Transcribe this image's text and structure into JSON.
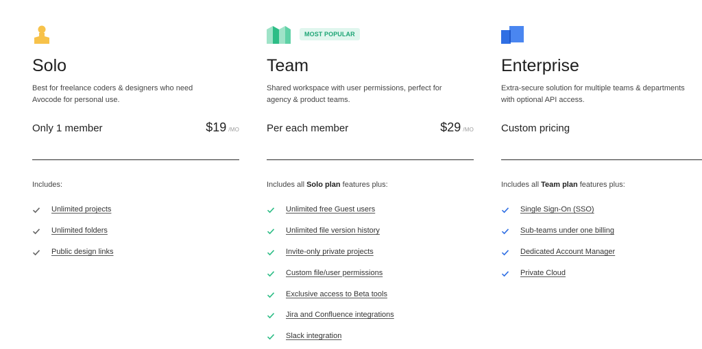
{
  "colors": {
    "solo_accent": "#f7c24a",
    "team_accent": "#2dbd86",
    "enterprise_accent": "#2f6fe4",
    "badge_bg": "#e0f6ee"
  },
  "plans": [
    {
      "name": "Solo",
      "icon": "person-icon",
      "description": "Best for freelance coders & designers who need Avocode for personal use.",
      "price_label": "Only 1 member",
      "price": "$19",
      "price_unit": "/MO",
      "includes_prefix": "Includes:",
      "includes_bold": "",
      "includes_suffix": "",
      "features": [
        "Unlimited projects",
        "Unlimited folders",
        "Public design links"
      ]
    },
    {
      "name": "Team",
      "icon": "team-icon",
      "badge": "MOST POPULAR",
      "description": "Shared workspace with user permissions, perfect for agency & product teams.",
      "price_label": "Per each member",
      "price": "$29",
      "price_unit": "/MO",
      "includes_prefix": "Includes all ",
      "includes_bold": "Solo plan",
      "includes_suffix": " features plus:",
      "features": [
        "Unlimited free Guest users",
        "Unlimited file version history",
        "Invite-only private projects",
        "Custom file/user permissions",
        "Exclusive access to Beta tools",
        "Jira and Confluence integrations",
        "Slack integration"
      ]
    },
    {
      "name": "Enterprise",
      "icon": "enterprise-icon",
      "description": "Extra-secure solution for multiple teams & departments with optional API access.",
      "price_label": "Custom pricing",
      "includes_prefix": "Includes all ",
      "includes_bold": "Team plan",
      "includes_suffix": " features plus:",
      "features": [
        "Single Sign-On (SSO)",
        "Sub-teams under one billing",
        "Dedicated Account Manager",
        "Private Cloud"
      ]
    }
  ]
}
